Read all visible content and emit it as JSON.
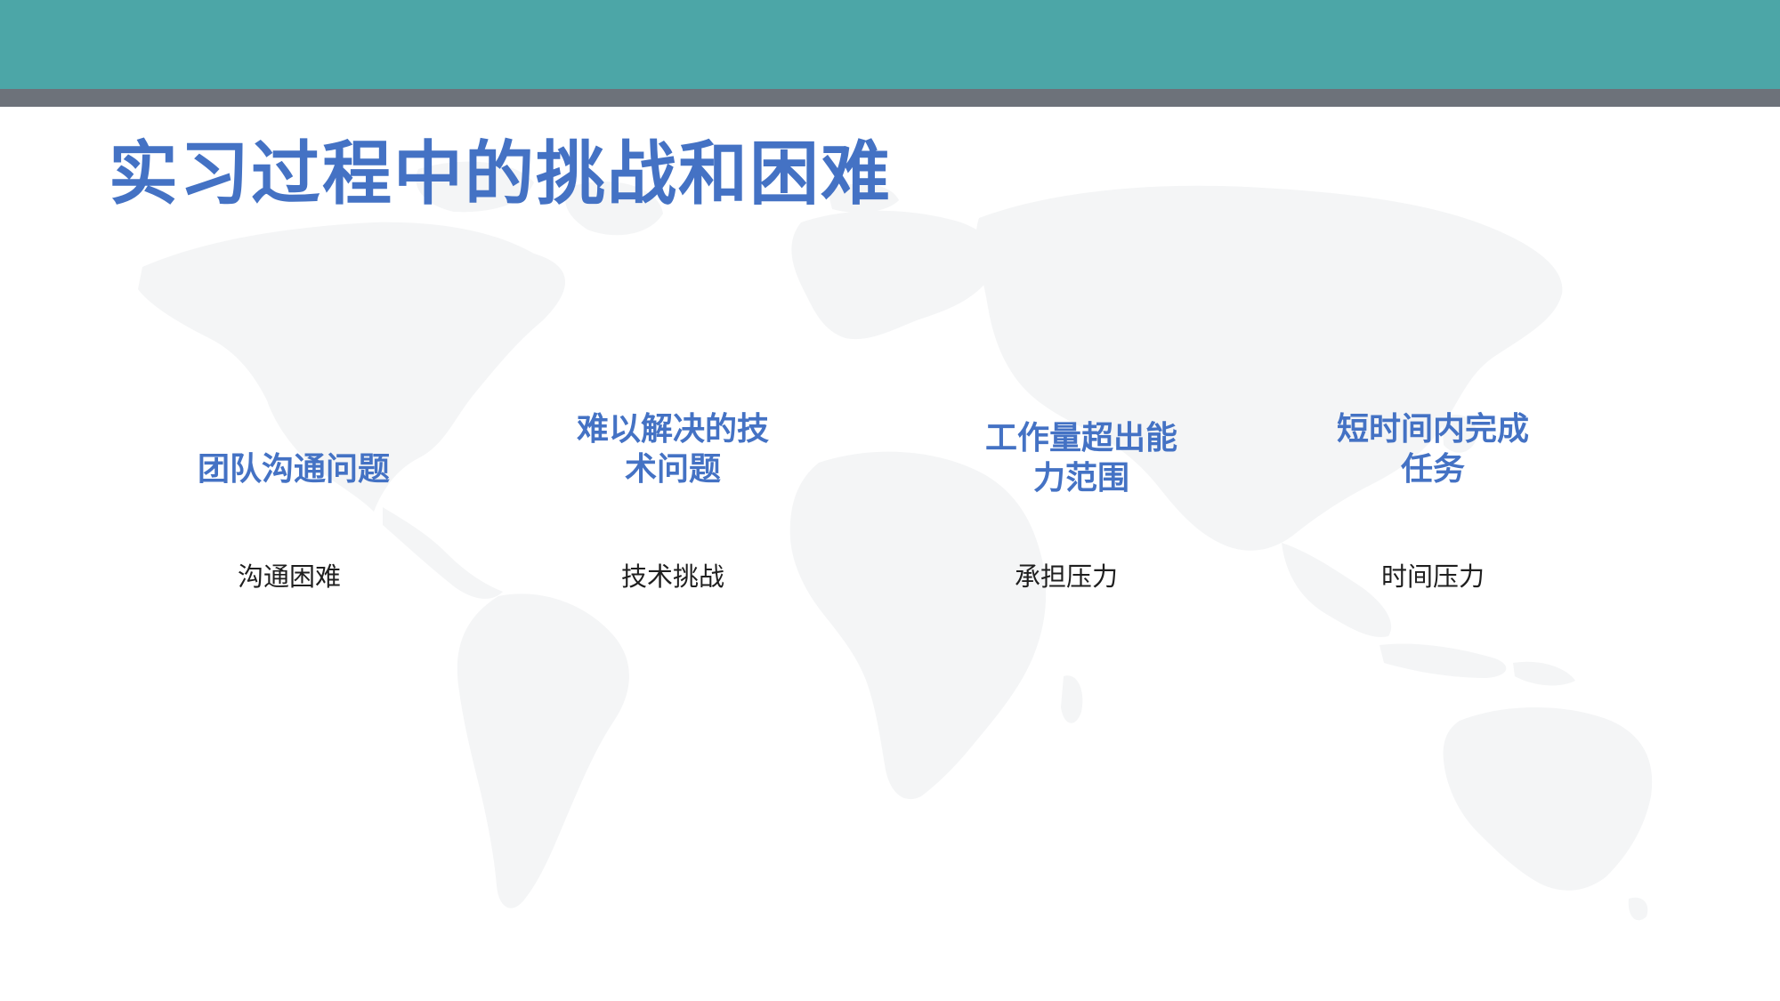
{
  "slide": {
    "title": "实习过程中的挑战和困难",
    "colors": {
      "top_band": "#4ca6a7",
      "gray_band": "#6d727a",
      "accent_text": "#4472c4",
      "body_text": "#1f1f1f",
      "map": "#f4f5f6"
    },
    "background_icon": "world-map-icon",
    "items": [
      {
        "heading": "团队沟通问题",
        "body": "沟通困难"
      },
      {
        "heading": "难以解决的技术问题",
        "body": "技术挑战"
      },
      {
        "heading": "工作量超出能力范围",
        "body": "承担压力"
      },
      {
        "heading": "短时间内完成任务",
        "body": "时间压力"
      }
    ]
  }
}
